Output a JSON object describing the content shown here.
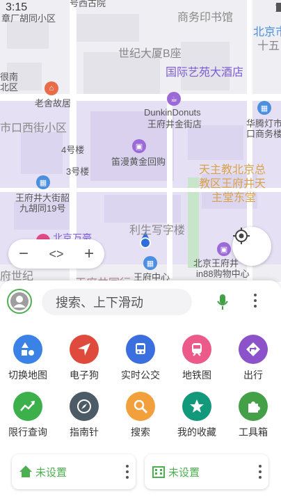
{
  "status_bar": {
    "time": "3:15"
  },
  "map": {
    "labels": {
      "top_street": "号西古院",
      "hutong": "章厂胡同小区",
      "commercial_press": "商务印书馆",
      "beijing_city": "北京市",
      "fifteen": "十五",
      "century_tower": "世纪大厦B座",
      "intl_hotel": "国际艺苑大酒店",
      "left_yinhe": "很南",
      "left_north": "北区",
      "laoshe": "老舍故居",
      "dunkin_1": "DunkinDonuts",
      "dunkin_2": "王府井金街店",
      "huatengdeng": "华腾灯市",
      "kouwu": "口商务楼",
      "xijie": "市口西街小区",
      "bldg4": "4号楼",
      "bldg3": "3号楼",
      "dimanhuang": "笛漫黄金回购",
      "cathedral_1": "天主教北京总",
      "cathedral_2": "教区王府井天",
      "cathedral_3": "主堂东堂",
      "wfj_street_1": "王府井大街韶",
      "wfj_street_2": "九胡同19号",
      "lisheng": "利生写字楼",
      "wanhua": "北京万豪",
      "century_left": "府世纪",
      "in88_1": "北京王府井",
      "in88_2": "in88购物中心",
      "wfj_center": "王府中心",
      "wfj_church_bottom": "王府井园行"
    }
  },
  "controls": {
    "zoom_out": "−",
    "code": "<>",
    "zoom_in": "+"
  },
  "search": {
    "placeholder": "搜索、上下滑动"
  },
  "tools": [
    {
      "label": "切换地图",
      "color": "#3b82e6",
      "icon": "shapes-icon"
    },
    {
      "label": "电子狗",
      "color": "#e04a3c",
      "icon": "navigation-icon"
    },
    {
      "label": "实时公交",
      "color": "#3b6fe0",
      "icon": "bus-icon"
    },
    {
      "label": "地铁图",
      "color": "#ec5a8a",
      "icon": "subway-icon"
    },
    {
      "label": "出行",
      "color": "#8b52c9",
      "icon": "turn-icon"
    },
    {
      "label": "限行查询",
      "color": "#3cb04a",
      "icon": "trend-icon"
    },
    {
      "label": "指南针",
      "color": "#4d5b66",
      "icon": "compass-icon"
    },
    {
      "label": "搜索",
      "color": "#f2a03c",
      "icon": "search-icon"
    },
    {
      "label": "我的收藏",
      "color": "#12987a",
      "icon": "star-icon"
    },
    {
      "label": "工具箱",
      "color": "#43a047",
      "icon": "puzzle-icon"
    }
  ],
  "shortcuts": {
    "home": "未设置",
    "work": "未设置"
  }
}
